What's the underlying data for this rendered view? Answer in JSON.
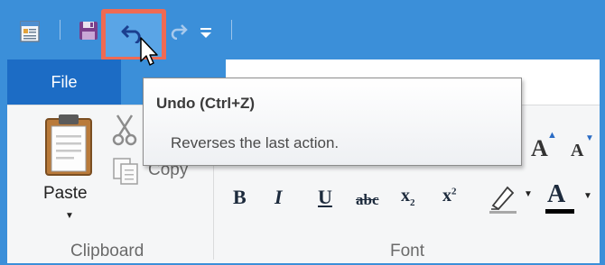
{
  "quick_access": {
    "items": [
      "properties-icon",
      "save-icon",
      "undo-icon",
      "redo-icon",
      "customize-dropdown-icon"
    ]
  },
  "tabs": {
    "file_label": "File"
  },
  "clipboard": {
    "paste_label": "Paste",
    "copy_label": "Copy",
    "group_label": "Clipboard"
  },
  "font": {
    "group_label": "Font"
  },
  "tooltip": {
    "title": "Undo (Ctrl+Z)",
    "description": "Reverses the last action."
  },
  "colors": {
    "title_bar": "#3b8fd9",
    "file_tab": "#1c6cc5",
    "highlight": "#f06a53",
    "font_color_underline": "#000000"
  }
}
